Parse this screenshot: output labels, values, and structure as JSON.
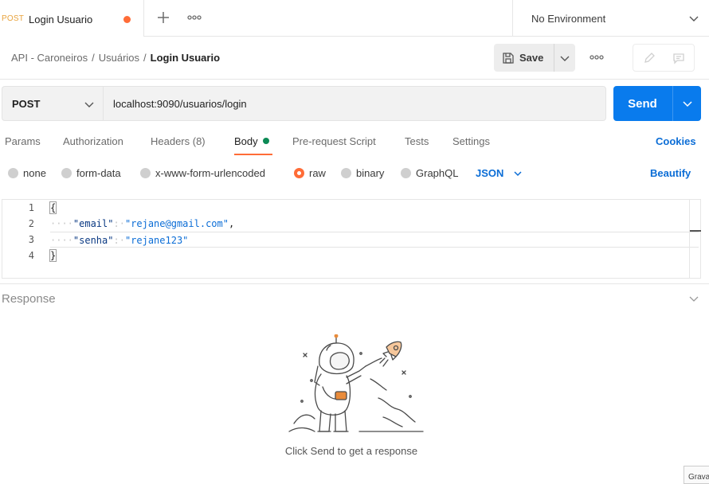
{
  "tab": {
    "method": "POST",
    "title": "Login Usuario"
  },
  "environment": {
    "label": "No Environment"
  },
  "breadcrumb": {
    "root": "API - Caroneiros",
    "folder": "Usuários",
    "current": "Login Usuario",
    "separator": "/"
  },
  "toolbar": {
    "save_label": "Save"
  },
  "request": {
    "method": "POST",
    "url": "localhost:9090/usuarios/login",
    "send_label": "Send"
  },
  "request_tabs": [
    "Params",
    "Authorization",
    "Headers (8)",
    "Body",
    "Pre-request Script",
    "Tests",
    "Settings"
  ],
  "cookies_label": "Cookies",
  "body_types": [
    "none",
    "form-data",
    "x-www-form-urlencoded",
    "raw",
    "binary",
    "GraphQL"
  ],
  "body_format": "JSON",
  "beautify_label": "Beautify",
  "editor": {
    "line_numbers": [
      "1",
      "2",
      "3",
      "4"
    ],
    "open_brace": "{",
    "close_brace": "}",
    "indent": "····",
    "line2": {
      "key": "\"email\"",
      "colon": ":·",
      "value": "\"rejane@gmail.com\"",
      "comma": ","
    },
    "line3": {
      "key": "\"senha\"",
      "colon": ":·",
      "value": "\"rejane123\""
    }
  },
  "response": {
    "title": "Response",
    "hint": "Click Send to get a response"
  },
  "overlay_text": "Grava",
  "colors": {
    "accent": "#ff6c37",
    "primary": "#097bed",
    "link": "#0b6dd6",
    "method_tab": "#e8a33d"
  }
}
